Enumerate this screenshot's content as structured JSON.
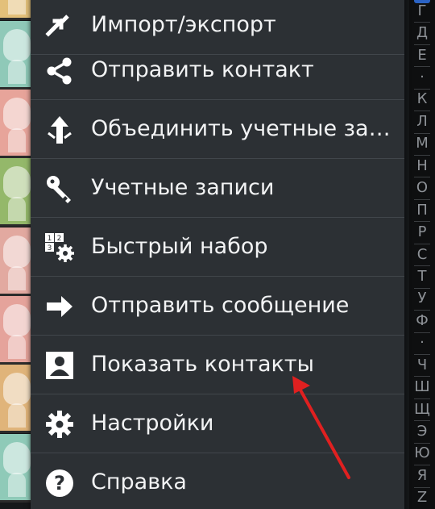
{
  "menu": {
    "items": [
      {
        "label": "Импорт/экспорт",
        "icon": "import-export-icon"
      },
      {
        "label": "Отправить контакт",
        "icon": "share-icon"
      },
      {
        "label": "Объединить учетные за…",
        "icon": "merge-icon"
      },
      {
        "label": "Учетные записи",
        "icon": "key-icon"
      },
      {
        "label": "Быстрый набор",
        "icon": "speed-dial-icon"
      },
      {
        "label": "Отправить сообщение",
        "icon": "arrow-right-icon"
      },
      {
        "label": "Показать контакты",
        "icon": "contact-card-icon"
      },
      {
        "label": "Настройки",
        "icon": "gear-icon"
      },
      {
        "label": "Справка",
        "icon": "help-icon"
      }
    ]
  },
  "index_letters": [
    "Г",
    "Д",
    "Е",
    "·",
    "К",
    "Л",
    "М",
    "Н",
    "О",
    "П",
    "Р",
    "С",
    "Т",
    "У",
    "Ф",
    "·",
    "Ч",
    "Ш",
    "Щ",
    "Э",
    "Ю",
    "Я",
    "Z"
  ],
  "avatar_colors": [
    "#e3c07a",
    "#8fc9b8",
    "#e7a49a",
    "#94b86a",
    "#e2a9a0",
    "#e5a39b",
    "#e0b47a",
    "#8fcab8"
  ],
  "colors": {
    "menu_bg": "#2c3034",
    "divider": "#41464b",
    "annotation_arrow": "#e02020"
  }
}
